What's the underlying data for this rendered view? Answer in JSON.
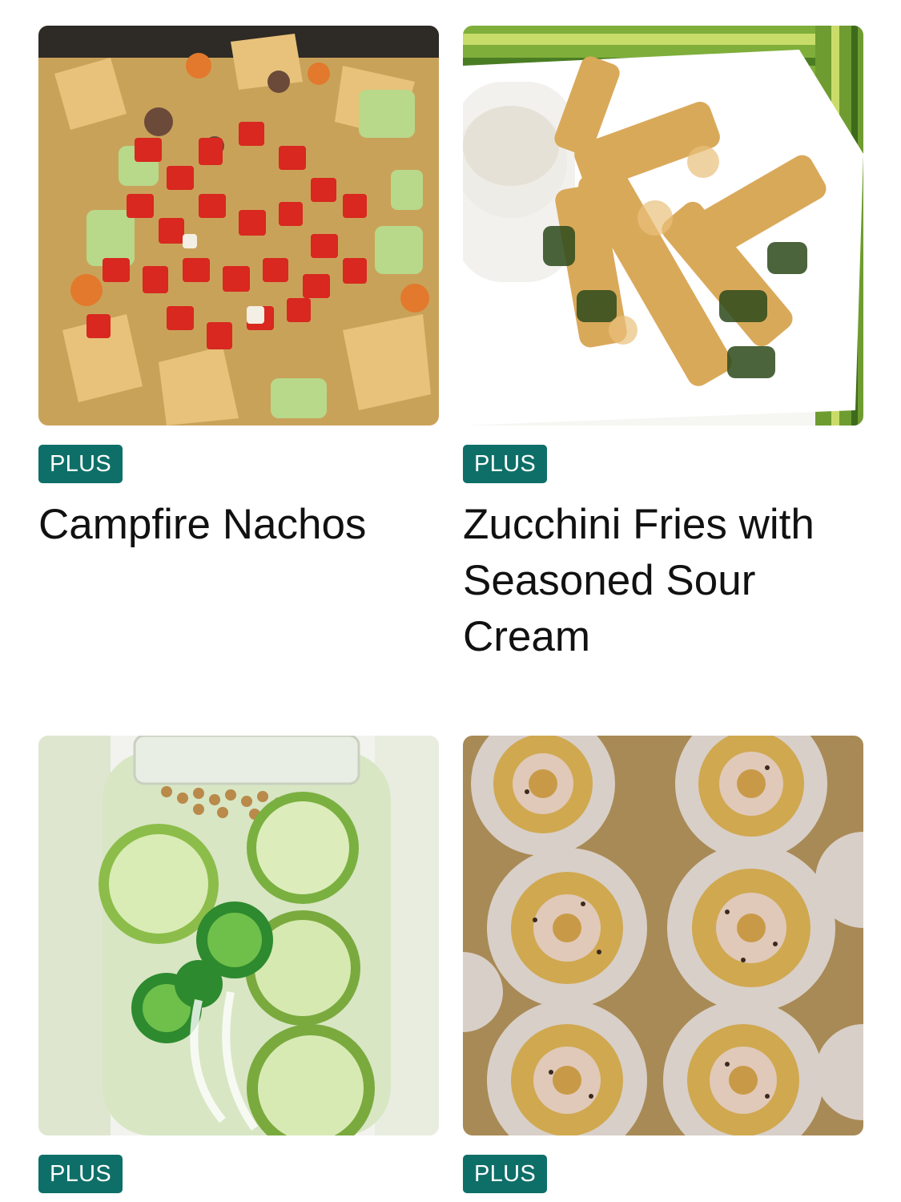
{
  "theme": {
    "badge_color": "#0e6f68",
    "text_color": "#111111",
    "background": "#ffffff"
  },
  "recipes": [
    {
      "badge": "PLUS",
      "title": "Campfire Nachos",
      "image_icon": "nachos-photo"
    },
    {
      "badge": "PLUS",
      "title": "Zucchini Fries with Seasoned Sour Cream",
      "image_icon": "zucchini-fries-photo"
    },
    {
      "badge": "PLUS",
      "title": "",
      "image_icon": "pickles-photo"
    },
    {
      "badge": "PLUS",
      "title": "",
      "image_icon": "pinwheels-photo"
    }
  ]
}
